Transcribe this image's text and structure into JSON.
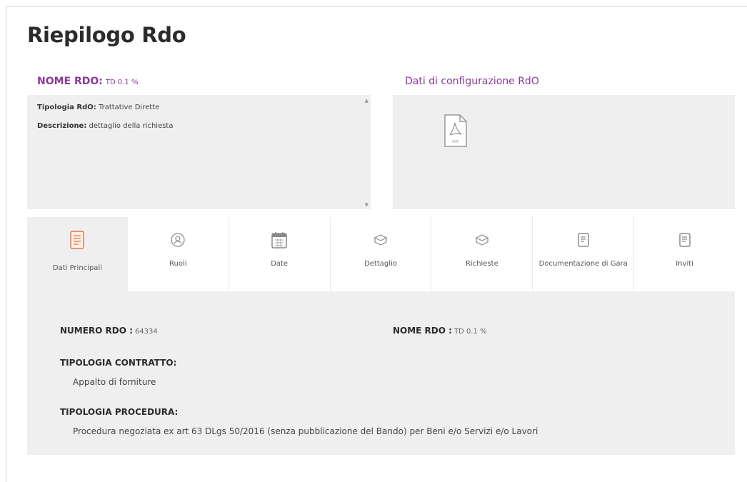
{
  "page": {
    "title": "Riepilogo Rdo"
  },
  "rdo_card": {
    "header_label": "NOME RDO:",
    "header_value": "TD 0.1 %",
    "rows": [
      {
        "label": "Tipologia RdO:",
        "value": "Trattative Dirette"
      },
      {
        "label": "Descrizione:",
        "value": "dettaglio della richiesta"
      }
    ]
  },
  "config_card": {
    "header": "Dati di configurazione RdO",
    "icon": "pdf-file-icon",
    "icon_caption": "PDF"
  },
  "tabs": [
    {
      "label": "Dati Principali",
      "icon": "checklist-icon",
      "active": true
    },
    {
      "label": "Ruoli",
      "icon": "user-badge-icon",
      "active": false
    },
    {
      "label": "Date",
      "icon": "calendar-icon",
      "active": false
    },
    {
      "label": "Dettaglio",
      "icon": "box-icon",
      "active": false
    },
    {
      "label": "Richieste",
      "icon": "box-icon",
      "active": false
    },
    {
      "label": "Documentazione di Gara",
      "icon": "document-icon",
      "active": false
    },
    {
      "label": "Inviti",
      "icon": "document-icon",
      "active": false
    }
  ],
  "details": {
    "numero_label": "NUMERO RDO :",
    "numero_value": "64334",
    "nome_label": "NOME RDO :",
    "nome_value": "TD 0.1 %",
    "contratto_label": "TIPOLOGIA CONTRATTO:",
    "contratto_value": "Appalto di forniture",
    "procedura_label": "TIPOLOGIA PROCEDURA:",
    "procedura_value": "Procedura negoziata ex art 63 DLgs 50/2016 (senza pubblicazione del Bando) per Beni e/o Servizi e/o Lavori"
  },
  "colors": {
    "accent": "#8a3a97",
    "active_icon": "#e07a4f",
    "panel_bg": "#efefef"
  }
}
